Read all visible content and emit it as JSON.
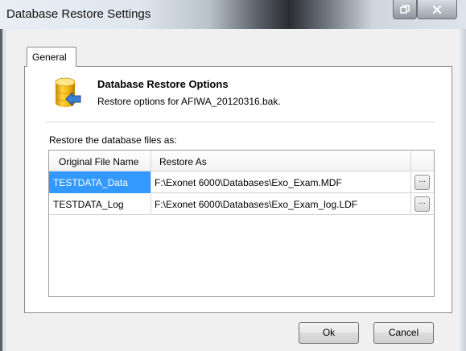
{
  "window": {
    "title": "Database Restore Settings"
  },
  "tabs": [
    {
      "label": "General",
      "selected": true
    }
  ],
  "header": {
    "title": "Database Restore Options",
    "subtitle": "Restore options for AFIWA_20120316.bak.",
    "icon": "database-restore-icon"
  },
  "restore_label": "Restore the database files as:",
  "grid": {
    "columns": [
      "Original File Name",
      "Restore As",
      ""
    ],
    "rows": [
      {
        "original": "TESTDATA_Data",
        "restore_as": "F:\\Exonet 6000\\Databases\\Exo_Exam.MDF",
        "browse": "...",
        "selected": true
      },
      {
        "original": "TESTDATA_Log",
        "restore_as": "F:\\Exonet 6000\\Databases\\Exo_Exam_log.LDF",
        "browse": "...",
        "selected": false
      }
    ]
  },
  "buttons": {
    "ok": "Ok",
    "cancel": "Cancel"
  },
  "colors": {
    "selection": "#3399ff",
    "dialog_background": "#f0f0f0"
  }
}
